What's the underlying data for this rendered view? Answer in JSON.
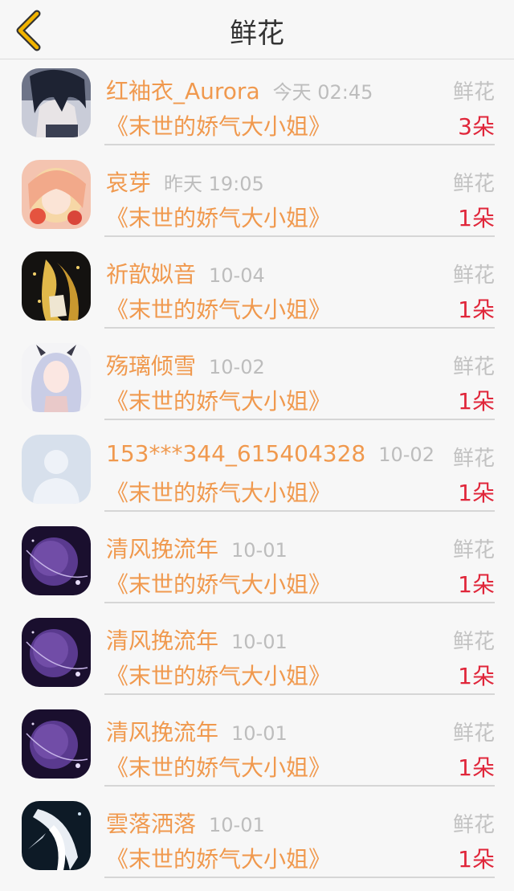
{
  "header": {
    "title": "鲜花",
    "back_icon": "chevron-left-icon",
    "accent": "#f2b400"
  },
  "colors": {
    "name": "#f0994e",
    "count": "#e0263a",
    "muted": "#bdbdbd"
  },
  "records": [
    {
      "user": "红袖衣_Aurora",
      "time": "今天 02:45",
      "gift": "鲜花",
      "book": "《末世的娇气大小姐》",
      "count": "3朵",
      "avatar": "anime-boy-avatar"
    },
    {
      "user": "哀芽",
      "time": "昨天 19:05",
      "gift": "鲜花",
      "book": "《末世的娇气大小姐》",
      "count": "1朵",
      "avatar": "anime-girl-pink-avatar"
    },
    {
      "user": "祈歆姒音",
      "time": "10-04",
      "gift": "鲜花",
      "book": "《末世的娇气大小姐》",
      "count": "1朵",
      "avatar": "anime-golden-avatar"
    },
    {
      "user": "殇璃倾雪",
      "time": "10-02",
      "gift": "鲜花",
      "book": "《末世的娇气大小姐》",
      "count": "1朵",
      "avatar": "anime-white-hair-avatar"
    },
    {
      "user": "153***344_615404328",
      "time": "10-02",
      "gift": "鲜花",
      "book": "《末世的娇气大小姐》",
      "count": "1朵",
      "avatar": "default-user-avatar"
    },
    {
      "user": "清风挽流年",
      "time": "10-01",
      "gift": "鲜花",
      "book": "《末世的娇气大小姐》",
      "count": "1朵",
      "avatar": "purple-moon-avatar"
    },
    {
      "user": "清风挽流年",
      "time": "10-01",
      "gift": "鲜花",
      "book": "《末世的娇气大小姐》",
      "count": "1朵",
      "avatar": "purple-moon-avatar"
    },
    {
      "user": "清风挽流年",
      "time": "10-01",
      "gift": "鲜花",
      "book": "《末世的娇气大小姐》",
      "count": "1朵",
      "avatar": "purple-moon-avatar"
    },
    {
      "user": "雲落洒落",
      "time": "10-01",
      "gift": "鲜花",
      "book": "《末世的娇气大小姐》",
      "count": "1朵",
      "avatar": "anime-dark-white-avatar"
    }
  ]
}
